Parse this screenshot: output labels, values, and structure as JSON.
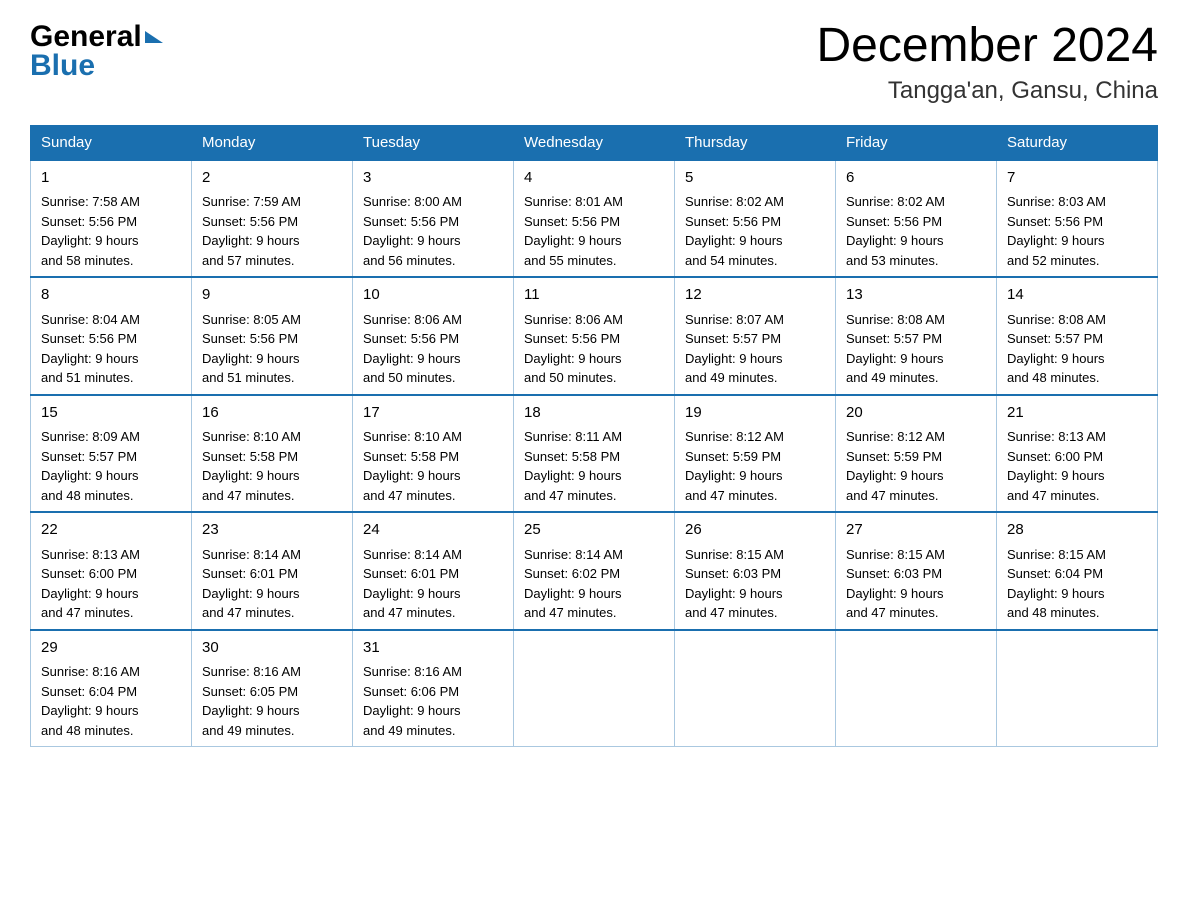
{
  "logo": {
    "general": "General",
    "blue": "Blue"
  },
  "title": "December 2024",
  "subtitle": "Tangga'an, Gansu, China",
  "days": [
    "Sunday",
    "Monday",
    "Tuesday",
    "Wednesday",
    "Thursday",
    "Friday",
    "Saturday"
  ],
  "weeks": [
    [
      {
        "num": "1",
        "sunrise": "7:58 AM",
        "sunset": "5:56 PM",
        "daylight": "9 hours and 58 minutes."
      },
      {
        "num": "2",
        "sunrise": "7:59 AM",
        "sunset": "5:56 PM",
        "daylight": "9 hours and 57 minutes."
      },
      {
        "num": "3",
        "sunrise": "8:00 AM",
        "sunset": "5:56 PM",
        "daylight": "9 hours and 56 minutes."
      },
      {
        "num": "4",
        "sunrise": "8:01 AM",
        "sunset": "5:56 PM",
        "daylight": "9 hours and 55 minutes."
      },
      {
        "num": "5",
        "sunrise": "8:02 AM",
        "sunset": "5:56 PM",
        "daylight": "9 hours and 54 minutes."
      },
      {
        "num": "6",
        "sunrise": "8:02 AM",
        "sunset": "5:56 PM",
        "daylight": "9 hours and 53 minutes."
      },
      {
        "num": "7",
        "sunrise": "8:03 AM",
        "sunset": "5:56 PM",
        "daylight": "9 hours and 52 minutes."
      }
    ],
    [
      {
        "num": "8",
        "sunrise": "8:04 AM",
        "sunset": "5:56 PM",
        "daylight": "9 hours and 51 minutes."
      },
      {
        "num": "9",
        "sunrise": "8:05 AM",
        "sunset": "5:56 PM",
        "daylight": "9 hours and 51 minutes."
      },
      {
        "num": "10",
        "sunrise": "8:06 AM",
        "sunset": "5:56 PM",
        "daylight": "9 hours and 50 minutes."
      },
      {
        "num": "11",
        "sunrise": "8:06 AM",
        "sunset": "5:56 PM",
        "daylight": "9 hours and 50 minutes."
      },
      {
        "num": "12",
        "sunrise": "8:07 AM",
        "sunset": "5:57 PM",
        "daylight": "9 hours and 49 minutes."
      },
      {
        "num": "13",
        "sunrise": "8:08 AM",
        "sunset": "5:57 PM",
        "daylight": "9 hours and 49 minutes."
      },
      {
        "num": "14",
        "sunrise": "8:08 AM",
        "sunset": "5:57 PM",
        "daylight": "9 hours and 48 minutes."
      }
    ],
    [
      {
        "num": "15",
        "sunrise": "8:09 AM",
        "sunset": "5:57 PM",
        "daylight": "9 hours and 48 minutes."
      },
      {
        "num": "16",
        "sunrise": "8:10 AM",
        "sunset": "5:58 PM",
        "daylight": "9 hours and 47 minutes."
      },
      {
        "num": "17",
        "sunrise": "8:10 AM",
        "sunset": "5:58 PM",
        "daylight": "9 hours and 47 minutes."
      },
      {
        "num": "18",
        "sunrise": "8:11 AM",
        "sunset": "5:58 PM",
        "daylight": "9 hours and 47 minutes."
      },
      {
        "num": "19",
        "sunrise": "8:12 AM",
        "sunset": "5:59 PM",
        "daylight": "9 hours and 47 minutes."
      },
      {
        "num": "20",
        "sunrise": "8:12 AM",
        "sunset": "5:59 PM",
        "daylight": "9 hours and 47 minutes."
      },
      {
        "num": "21",
        "sunrise": "8:13 AM",
        "sunset": "6:00 PM",
        "daylight": "9 hours and 47 minutes."
      }
    ],
    [
      {
        "num": "22",
        "sunrise": "8:13 AM",
        "sunset": "6:00 PM",
        "daylight": "9 hours and 47 minutes."
      },
      {
        "num": "23",
        "sunrise": "8:14 AM",
        "sunset": "6:01 PM",
        "daylight": "9 hours and 47 minutes."
      },
      {
        "num": "24",
        "sunrise": "8:14 AM",
        "sunset": "6:01 PM",
        "daylight": "9 hours and 47 minutes."
      },
      {
        "num": "25",
        "sunrise": "8:14 AM",
        "sunset": "6:02 PM",
        "daylight": "9 hours and 47 minutes."
      },
      {
        "num": "26",
        "sunrise": "8:15 AM",
        "sunset": "6:03 PM",
        "daylight": "9 hours and 47 minutes."
      },
      {
        "num": "27",
        "sunrise": "8:15 AM",
        "sunset": "6:03 PM",
        "daylight": "9 hours and 47 minutes."
      },
      {
        "num": "28",
        "sunrise": "8:15 AM",
        "sunset": "6:04 PM",
        "daylight": "9 hours and 48 minutes."
      }
    ],
    [
      {
        "num": "29",
        "sunrise": "8:16 AM",
        "sunset": "6:04 PM",
        "daylight": "9 hours and 48 minutes."
      },
      {
        "num": "30",
        "sunrise": "8:16 AM",
        "sunset": "6:05 PM",
        "daylight": "9 hours and 49 minutes."
      },
      {
        "num": "31",
        "sunrise": "8:16 AM",
        "sunset": "6:06 PM",
        "daylight": "9 hours and 49 minutes."
      },
      null,
      null,
      null,
      null
    ]
  ],
  "labels": {
    "sunrise": "Sunrise:",
    "sunset": "Sunset:",
    "daylight": "Daylight:"
  }
}
